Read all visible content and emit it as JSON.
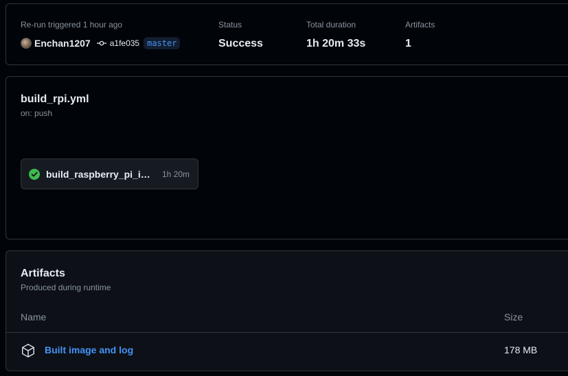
{
  "summary": {
    "trigger_label": "Re-run triggered 1 hour ago",
    "actor": "Enchan1207",
    "commit_sha": "a1fe035",
    "branch": "master",
    "status_label": "Status",
    "status_value": "Success",
    "duration_label": "Total duration",
    "duration_value": "1h 20m 33s",
    "artifacts_label": "Artifacts",
    "artifacts_value": "1"
  },
  "workflow": {
    "file": "build_rpi.yml",
    "trigger": "on: push",
    "jobs": [
      {
        "name": "build_raspberry_pi_image",
        "duration": "1h 20m",
        "status": "success"
      }
    ]
  },
  "artifacts": {
    "title": "Artifacts",
    "subtitle": "Produced during runtime",
    "columns": [
      "Name",
      "Size"
    ],
    "rows": [
      {
        "name": "Built image and log",
        "size": "178 MB"
      }
    ]
  },
  "colors": {
    "background": "#010409",
    "border": "#30363d",
    "link": "#4493f8",
    "success": "#3fb950"
  },
  "icons": [
    "avatar",
    "git-commit-icon",
    "check-circle-icon",
    "package-icon"
  ]
}
